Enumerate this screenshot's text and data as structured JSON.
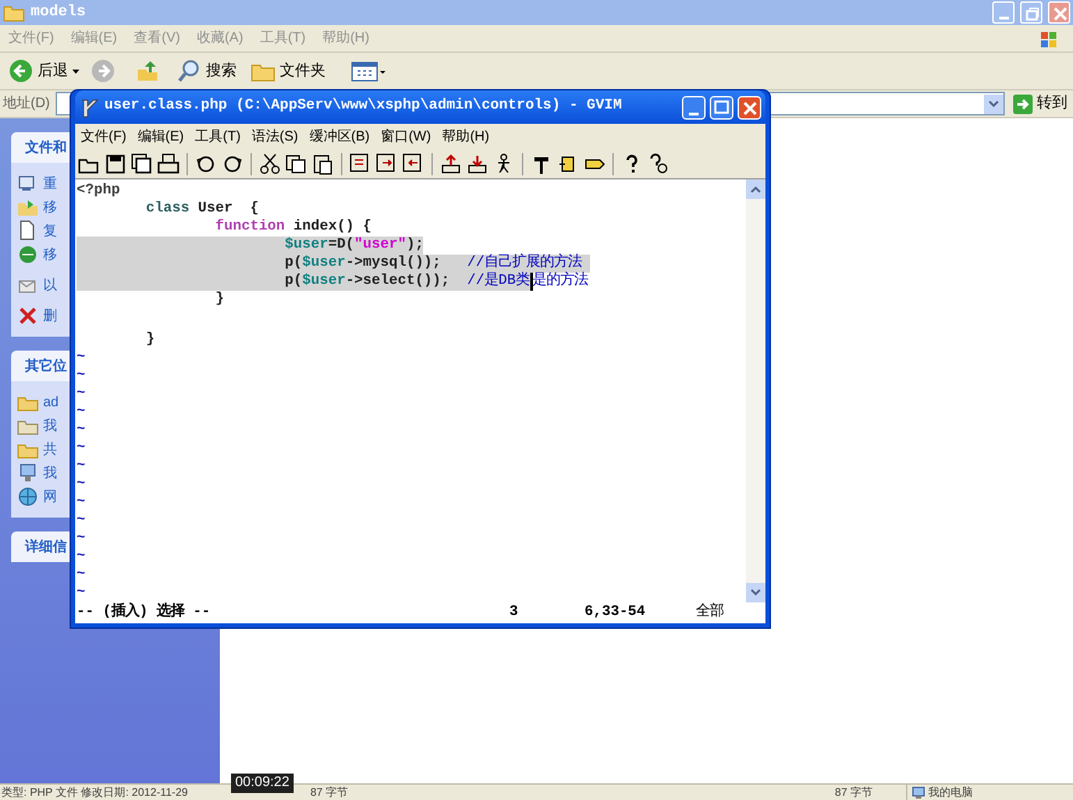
{
  "explorer": {
    "title": "models",
    "menu": [
      "文件(F)",
      "编辑(E)",
      "查看(V)",
      "收藏(A)",
      "工具(T)",
      "帮助(H)"
    ],
    "toolbar": {
      "back": "后退",
      "search": "搜索",
      "folders": "文件夹"
    },
    "address": {
      "label": "地址(D)",
      "go": "转到"
    },
    "sidebar": [
      {
        "title": "文件和",
        "items": [
          "重",
          "移",
          "复",
          "移",
          "以",
          "删"
        ]
      },
      {
        "title": "其它位",
        "items": [
          "ad",
          "我",
          "共",
          "我",
          "网"
        ]
      },
      {
        "title": "详细信"
      }
    ],
    "status": {
      "left": "类型: PHP 文件 修改日期: 2012-11-29",
      "size_left": "87 字节",
      "size_right": "87 字节",
      "location": "我的电脑"
    }
  },
  "gvim": {
    "title": "user.class.php (C:\\AppServ\\www\\xsphp\\admin\\controls) - GVIM",
    "menu": [
      "文件(F)",
      "编辑(E)",
      "工具(T)",
      "语法(S)",
      "缓冲区(B)",
      "窗口(W)",
      "帮助(H)"
    ],
    "lines": [
      {
        "kind": "code",
        "tokens": [
          {
            "text": "<?php",
            "kind": "tag",
            "selected": false
          }
        ]
      },
      {
        "kind": "code",
        "tokens": [
          {
            "text": "        class",
            "kind": "keyword",
            "selected": false
          },
          {
            "text": " User  {",
            "kind": "plain",
            "selected": false
          }
        ]
      },
      {
        "kind": "code",
        "tokens": [
          {
            "text": "                function",
            "kind": "function",
            "selected": false
          },
          {
            "text": " index() {",
            "kind": "plain",
            "selected": false
          }
        ]
      },
      {
        "kind": "code",
        "tokens": [
          {
            "text": "                        $user",
            "kind": "variable",
            "selected": true
          },
          {
            "text": "=D(",
            "kind": "plain",
            "selected": true
          },
          {
            "text": "\"user\"",
            "kind": "string",
            "selected": true
          },
          {
            "text": ");",
            "kind": "plain",
            "selected": true
          }
        ]
      },
      {
        "kind": "code",
        "tokens": [
          {
            "text": "                        p(",
            "kind": "plain",
            "selected": true
          },
          {
            "text": "$user",
            "kind": "variable",
            "selected": true
          },
          {
            "text": "->mysql());   ",
            "kind": "plain",
            "selected": true
          },
          {
            "text": "//自己扩展的方法 ",
            "kind": "comment",
            "selected": true
          }
        ]
      },
      {
        "kind": "code",
        "tokens": [
          {
            "text": "                        p(",
            "kind": "plain",
            "selected": true
          },
          {
            "text": "$user",
            "kind": "variable",
            "selected": true
          },
          {
            "text": "->select());  ",
            "kind": "plain",
            "selected": true
          },
          {
            "text": "//是DB类",
            "kind": "comment",
            "selected": true
          },
          {
            "text": "是的方法",
            "kind": "comment",
            "selected": false,
            "cursor": true
          }
        ]
      },
      {
        "kind": "code",
        "tokens": [
          {
            "text": "                }",
            "kind": "plain",
            "selected": false
          }
        ]
      },
      {
        "kind": "blank"
      },
      {
        "kind": "blank"
      },
      {
        "kind": "code",
        "tokens": [
          {
            "text": "        }",
            "kind": "plain",
            "selected": false
          }
        ]
      },
      {
        "kind": "tilde",
        "text": "~"
      },
      {
        "kind": "tilde",
        "text": "~"
      },
      {
        "kind": "tilde",
        "text": "~"
      },
      {
        "kind": "tilde",
        "text": "~"
      },
      {
        "kind": "tilde",
        "text": "~"
      },
      {
        "kind": "tilde",
        "text": "~"
      },
      {
        "kind": "tilde",
        "text": "~"
      },
      {
        "kind": "tilde",
        "text": "~"
      },
      {
        "kind": "tilde",
        "text": "~"
      },
      {
        "kind": "tilde",
        "text": "~"
      },
      {
        "kind": "tilde",
        "text": "~"
      },
      {
        "kind": "tilde",
        "text": "~"
      },
      {
        "kind": "tilde",
        "text": "~"
      },
      {
        "kind": "tilde",
        "text": "~"
      }
    ],
    "status": {
      "mode": "-- (插入) 选择 --",
      "selection": "3",
      "position": "6,33-54",
      "scroll": "全部"
    }
  },
  "video_time": "00:09:22"
}
